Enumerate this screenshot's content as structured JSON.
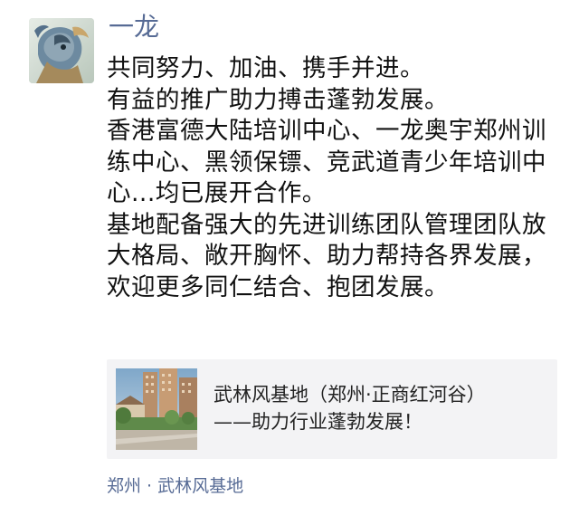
{
  "post": {
    "username": "一龙",
    "content_lines": [
      "共同努力、加油、携手并进。",
      "有益的推广助力搏击蓬勃发展。",
      "香港富德大陆培训中心、一龙奥宇郑州训练中心、黑领保镖、竞武道青少年培训中心...均已展开合作。",
      "基地配备强大的先进训练团队管理团队放大格局、敞开胸怀、助力帮持各界发展，欢迎更多同仁结合、抱团发展。"
    ],
    "link_card": {
      "title_line1": "武林风基地（郑州·正商红河谷）",
      "title_line2": "——助力行业蓬勃发展！",
      "thumbnail_icon": "building-photo-thumbnail"
    },
    "location": "郑州 · 武林风基地"
  },
  "colors": {
    "link_blue": "#576b95",
    "card_background": "#f3f3f5",
    "text": "#111111"
  }
}
